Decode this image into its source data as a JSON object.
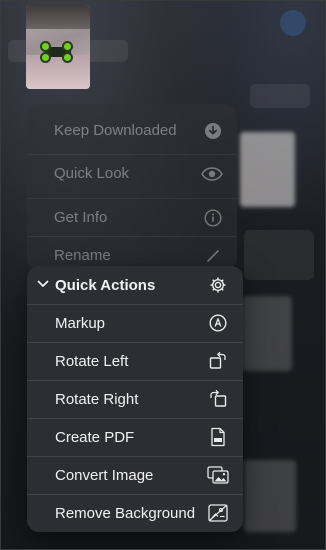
{
  "context_menu": {
    "items": [
      {
        "label": "Keep Downloaded",
        "icon": "download-circle-icon"
      },
      {
        "label": "Quick Look",
        "icon": "eye-icon"
      },
      {
        "label": "Get Info",
        "icon": "info-circle-icon"
      },
      {
        "label": "Rename",
        "icon": "pencil-icon"
      }
    ]
  },
  "quick_actions": {
    "header": "Quick Actions",
    "header_icon": "gear-icon",
    "items": [
      {
        "label": "Markup",
        "icon": "markup-pen-icon"
      },
      {
        "label": "Rotate Left",
        "icon": "rotate-left-icon"
      },
      {
        "label": "Rotate Right",
        "icon": "rotate-right-icon"
      },
      {
        "label": "Create PDF",
        "icon": "pdf-document-icon"
      },
      {
        "label": "Convert Image",
        "icon": "convert-image-icon"
      },
      {
        "label": "Remove Background",
        "icon": "remove-background-icon"
      }
    ]
  },
  "colors": {
    "panel": "#2d2e33",
    "text": "#f2f2f4",
    "dimmed_text": "#7a7b80"
  }
}
